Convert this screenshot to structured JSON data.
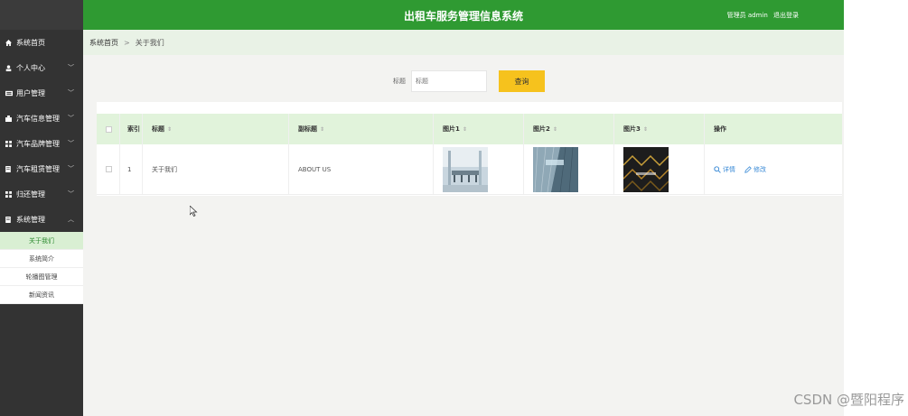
{
  "header": {
    "title": "出租车服务管理信息系统",
    "user_label": "管理员 admin",
    "logout_label": "退出登录",
    "color": "#2f9a32"
  },
  "sidebar": {
    "items": [
      {
        "label": "系统首页",
        "icon": "home-icon"
      },
      {
        "label": "个人中心",
        "icon": "person-icon"
      },
      {
        "label": "用户管理",
        "icon": "users-icon"
      },
      {
        "label": "汽车信息管理",
        "icon": "car-icon"
      },
      {
        "label": "汽车品牌管理",
        "icon": "grid-icon"
      },
      {
        "label": "汽车租赁管理",
        "icon": "doc-icon"
      },
      {
        "label": "归还管理",
        "icon": "grid-icon"
      },
      {
        "label": "系统管理",
        "icon": "doc-icon"
      }
    ],
    "submenu": [
      "关于我们",
      "系统简介",
      "轮播图管理",
      "新闻资讯"
    ]
  },
  "breadcrumb": {
    "home": "系统首页",
    "separator": ">",
    "current": "关于我们"
  },
  "search": {
    "label": "标题",
    "placeholder": "标题",
    "button": "查询",
    "button_color": "#f6c21d"
  },
  "table": {
    "columns": [
      "索引",
      "标题",
      "副标题",
      "图片1",
      "图片2",
      "图片3",
      "操作"
    ],
    "rows": [
      {
        "index": "1",
        "title": "关于我们",
        "subtitle": "ABOUT US",
        "images": [
          "meeting-room-photo",
          "glass-building-photo",
          "dark-abstract-photo"
        ],
        "actions": [
          "详情",
          "修改"
        ]
      }
    ]
  },
  "watermark": "CSDN @暨阳程序"
}
